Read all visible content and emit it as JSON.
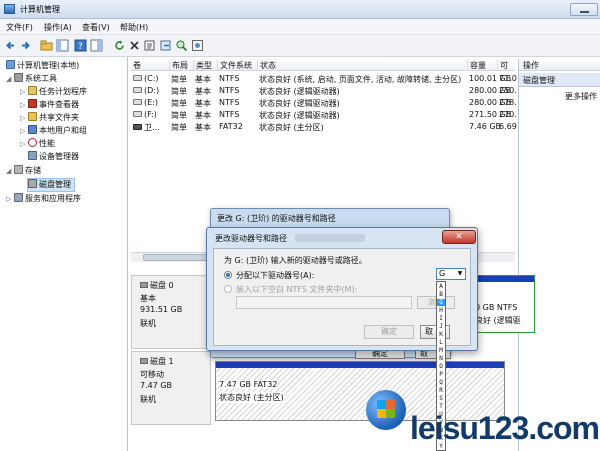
{
  "window": {
    "title": "计算机管理"
  },
  "menu": {
    "file": "文件(F)",
    "action": "操作(A)",
    "view": "查看(V)",
    "help": "帮助(H)"
  },
  "toolbar_icons": [
    "back-arrow-icon",
    "forward-arrow-icon",
    "folder-up-icon",
    "console-tree-icon",
    "help-icon",
    "panel-icon",
    "refresh-icon",
    "delete-icon",
    "properties-icon",
    "export-icon",
    "search-icon",
    "settings-icon"
  ],
  "tree": {
    "root": "计算机管理(本地)",
    "system_tools": "系统工具",
    "task_scheduler": "任务计划程序",
    "event_viewer": "事件查看器",
    "shared_folders": "共享文件夹",
    "local_users": "本地用户和组",
    "performance": "性能",
    "device_manager": "设备管理器",
    "storage": "存储",
    "disk_management": "磁盘管理",
    "services": "服务和应用程序"
  },
  "volumes": {
    "headers": [
      "卷",
      "布局",
      "类型",
      "文件系统",
      "状态",
      "容量",
      "可"
    ],
    "rows": [
      [
        "(C:)",
        "简单",
        "基本",
        "NTFS",
        "状态良好 (系统, 启动, 页面文件, 活动, 故障转储, 主分区)",
        "100.01 GB",
        "71.0"
      ],
      [
        "(D:)",
        "简单",
        "基本",
        "NTFS",
        "状态良好 (逻辑驱动器)",
        "280.00 GB",
        "250."
      ],
      [
        "(E:)",
        "简单",
        "基本",
        "NTFS",
        "状态良好 (逻辑驱动器)",
        "280.00 GB",
        "278."
      ],
      [
        "(F:)",
        "简单",
        "基本",
        "NTFS",
        "状态良好 (逻辑驱动器)",
        "271.50 GB",
        "270."
      ],
      [
        "卫...",
        "简单",
        "基本",
        "FAT32",
        "状态良好 (主分区)",
        "7.46 GB",
        "6.69"
      ]
    ]
  },
  "actions": {
    "header": "操作",
    "section": "磁盘管理",
    "more": "更多操作"
  },
  "disk0": {
    "name": "磁盘 0",
    "type": "基本",
    "size": "931.51 GB",
    "status": "联机",
    "vol_text1": "0 GB NTFS",
    "vol_text2": "良好 (逻辑驱"
  },
  "disk1": {
    "name": "磁盘 1",
    "type": "可移动",
    "size": "7.47 GB",
    "status": "联机",
    "vol_size": "7.47 GB FAT32",
    "vol_status": "状态良好 (主分区)"
  },
  "dialog_outer": {
    "title": "更改 G: (卫玠) 的驱动器号和路径",
    "ok": "确定",
    "other": "取"
  },
  "dialog_inner": {
    "title": "更改驱动器号和路径",
    "close": "✕",
    "prompt": "为 G: (卫玠) 输入新的驱动器号或路径。",
    "option_assign": "分配以下驱动器号(A):",
    "option_mount": "装入以下空白 NTFS 文件夹中(M):",
    "browse": "浏览",
    "ok": "确定",
    "cancel": "取"
  },
  "drive_letter": {
    "selected": "G",
    "options": [
      "A",
      "B",
      "G",
      "H",
      "I",
      "J",
      "K",
      "L",
      "M",
      "N",
      "O",
      "P",
      "Q",
      "R",
      "S",
      "T",
      "U",
      "V",
      "W",
      "X",
      "Y"
    ]
  },
  "watermark": {
    "text": "leisu123.com"
  }
}
